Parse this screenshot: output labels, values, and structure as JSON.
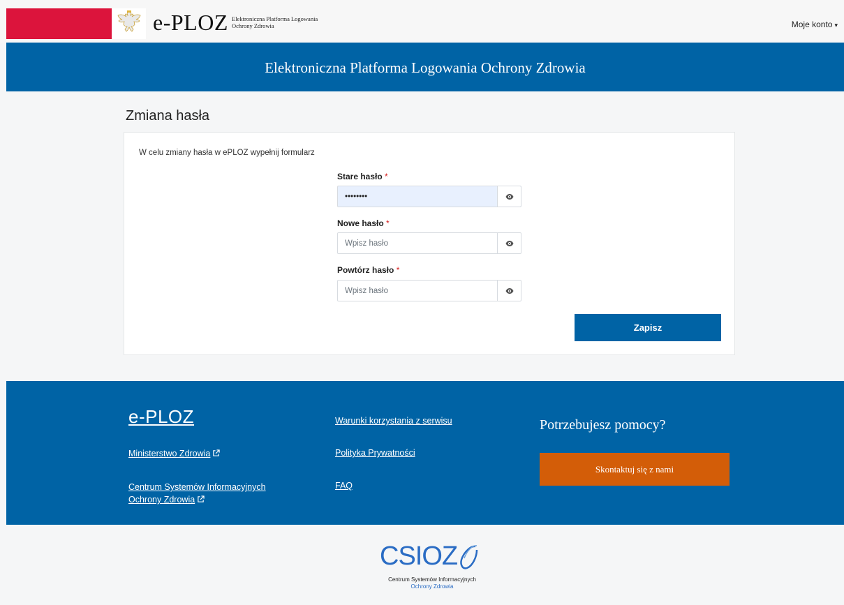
{
  "header": {
    "logo_text": "e-PLOZ",
    "logo_sub_line1": "Elektroniczna Platforma Logowania",
    "logo_sub_line2": "Ochrony Zdrowia",
    "account_label": "Moje konto",
    "account_caret": "▾"
  },
  "banner": {
    "title": "Elektroniczna Platforma Logowania Ochrony Zdrowia"
  },
  "form": {
    "page_title": "Zmiana hasła",
    "intro": "W celu zmiany hasła w ePLOZ wypełnij formularz",
    "required_mark": "*",
    "old_password": {
      "label": "Stare hasło",
      "value": "••••••••"
    },
    "new_password": {
      "label": "Nowe hasło",
      "placeholder": "Wpisz hasło"
    },
    "repeat_password": {
      "label": "Powtórz hasło",
      "placeholder": "Wpisz hasło"
    },
    "save_label": "Zapisz"
  },
  "footer": {
    "brand": "e-PLOZ",
    "ministry_link": "Ministerstwo Zdrowia",
    "csioz_link_line1": "Centrum Systemów Informacyjnych",
    "csioz_link_line2": "Ochrony Zdrowia",
    "terms_link": "Warunki korzystania z serwisu",
    "privacy_link": "Polityka Prywatności",
    "faq_link": "FAQ",
    "help_title": "Potrzebujesz pomocy?",
    "contact_label": "Skontaktuj się z nami"
  },
  "bottom_logo": {
    "word": "CSIOZ",
    "line1": "Centrum Systemów Informacyjnych",
    "line2": "Ochrony Zdrowia"
  },
  "colors": {
    "primary": "#0063a5",
    "accent": "#d35d08",
    "flag_red": "#dc143c"
  },
  "icons": [
    "polish-eagle-icon",
    "eye-icon",
    "external-link-icon",
    "caret-down-icon"
  ]
}
